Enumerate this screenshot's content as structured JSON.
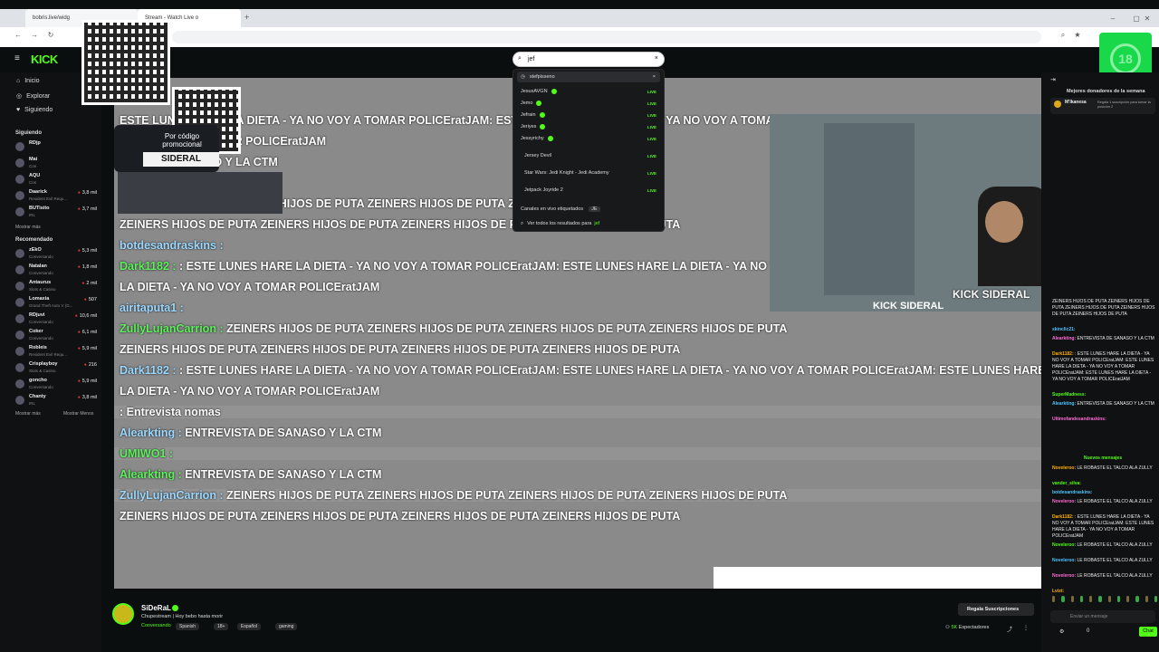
{
  "browser": {
    "tab1": "bobris.live/widg",
    "tab2": "Stream - Watch Live o",
    "url": ""
  },
  "app": {
    "logo": "KICK"
  },
  "search": {
    "value": "jef"
  },
  "nav": {
    "home": "Inicio",
    "explore": "Explorar",
    "following": "Siguiendo"
  },
  "sidebar": {
    "following_head": "Siguiendo",
    "following": [
      {
        "name": "RDjp",
        "game": "",
        "viewers": ""
      },
      {
        "name": "Mai",
        "game": "Con",
        "viewers": ""
      },
      {
        "name": "AQU",
        "game": "Con",
        "viewers": ""
      },
      {
        "name": "Daarick",
        "game": "Resident Evil Requ...",
        "viewers": "3,8 mil"
      },
      {
        "name": "BUTisito",
        "game": "IRL",
        "viewers": "3,7 mil"
      }
    ],
    "show_more": "Mostrar más",
    "recommended_head": "Recomendado",
    "recommended": [
      {
        "name": "zEkO",
        "game": "Conversando",
        "viewers": "5,3 mil"
      },
      {
        "name": "Natalan",
        "game": "Conversando",
        "viewers": "1,8 mil"
      },
      {
        "name": "Antaurus",
        "game": "Slots & Casino",
        "viewers": "2 mil"
      },
      {
        "name": "Lomaxia",
        "game": "Grand Theft Auto V (G...",
        "viewers": "507"
      },
      {
        "name": "RDjuvi",
        "game": "Conversando",
        "viewers": "10,6 mil"
      },
      {
        "name": "Coker",
        "game": "Conversando",
        "viewers": "6,1 mil"
      },
      {
        "name": "Robleis",
        "game": "Resident Evil Requ...",
        "viewers": "5,9 mil"
      },
      {
        "name": "Crisplayboy",
        "game": "Slots & Casino",
        "viewers": "216"
      },
      {
        "name": "goncho",
        "game": "Conversando",
        "viewers": "5,9 mil"
      },
      {
        "name": "Chanty",
        "game": "IRL",
        "viewers": "3,8 mil"
      }
    ],
    "show_more2": "Mostrar más",
    "show_less": "Mostrar Menos"
  },
  "promo": {
    "line1": "Por código",
    "line2": "promocional",
    "code": "SIDERAL"
  },
  "dropdown": {
    "recent": "stefpisseno",
    "channels": [
      "JesusAVGN",
      "Jemo",
      "Jefrain",
      "Jeriyes",
      "Jessyrichy"
    ],
    "categories": [
      "Jersey Devil",
      "Star Wars: Jedi Knight - Jedi Academy",
      "Jetpack Joyride 2"
    ],
    "live_label": "LIVE",
    "tagged": "Canales en vivo etiquetados",
    "tagged_chip": "JE",
    "see_all": "Ver todos los resultados para",
    "see_all_term": "jef"
  },
  "stream_chat": [
    {
      "user": "",
      "text": "ESTE LUNES HARE LA DIETA - YA NO VOY A TOMAR POLICEratJAM: ESTE LUNES HARE LA DIETA - YA NO VOY A TOMAR"
    },
    {
      "user": "",
      "text": "- YA NO VOY A TOMAR POLICEratJAM"
    },
    {
      "user": "",
      "text": "VISTA DE SANASO Y LA CTM"
    },
    {
      "user": "UltimofandesandraskIns :",
      "text": ""
    },
    {
      "user": "ZullyLujanCarrion :",
      "text": "ZEINERS HIJOS DE PUTA ZEINERS HIJOS DE PUTA ZEINERS HIJOS DE PUTA"
    },
    {
      "user": "",
      "text": "ZEINERS HIJOS DE PUTA ZEINERS HIJOS DE PUTA ZEINERS HIJOS DE PUTA ZEINERS HIJOS DE PUTA"
    },
    {
      "user": "botdesandraskins :",
      "text": ""
    },
    {
      "user": "Dark1182 :",
      "text": ": ESTE LUNES HARE LA DIETA - YA NO VOY A TOMAR POLICEratJAM: ESTE LUNES HARE LA DIETA - YA NO VOY A TOMAR POLICEratJAM: ESTE LUNES HARE"
    },
    {
      "user": "",
      "text": "LA DIETA - YA NO VOY A TOMAR POLICEratJAM"
    },
    {
      "user": "airitaputa1 :",
      "text": ""
    },
    {
      "user": "ZullyLujanCarrion :",
      "text": "ZEINERS HIJOS DE PUTA ZEINERS HIJOS DE PUTA ZEINERS HIJOS DE PUTA ZEINERS HIJOS DE PUTA"
    },
    {
      "user": "",
      "text": "ZEINERS HIJOS DE PUTA ZEINERS HIJOS DE PUTA ZEINERS HIJOS DE PUTA ZEINERS HIJOS DE PUTA"
    },
    {
      "user": "Dark1182 :",
      "text": ": ESTE LUNES HARE LA DIETA - YA NO VOY A TOMAR POLICEratJAM: ESTE LUNES HARE LA DIETA - YA NO VOY A TOMAR POLICEratJAM: ESTE LUNES HARE"
    },
    {
      "user": "",
      "text": "LA DIETA - YA NO VOY A TOMAR POLICEratJAM"
    },
    {
      "user": "",
      "text": ": Entrevista nomas"
    },
    {
      "user": "Alearkting :",
      "text": "ENTREVISTA DE SANASO Y LA CTM"
    },
    {
      "user": "UMIWO1 :",
      "text": ""
    },
    {
      "user": "Alearkting :",
      "text": "ENTREVISTA DE SANASO Y LA CTM"
    },
    {
      "user": "ZullyLujanCarrion :",
      "text": "ZEINERS HIJOS DE PUTA ZEINERS HIJOS DE PUTA ZEINERS HIJOS DE PUTA ZEINERS HIJOS DE PUTA"
    },
    {
      "user": "",
      "text": "ZEINERS HIJOS DE PUTA ZEINERS HIJOS DE PUTA ZEINERS HIJOS DE PUTA ZEINERS HIJOS DE PUTA"
    }
  ],
  "cam": {
    "label": "KICK SIDERAL",
    "label2": "KICK SIDERAL"
  },
  "channel": {
    "name": "SiDeRaL",
    "title": "Chupestream | Hoy bebo hasta morir",
    "category": "Conversando",
    "tags": [
      "Spanish",
      "18+",
      "Español",
      "gaming"
    ],
    "sub_button": "Regala Suscripciones",
    "viewers": "5K",
    "viewers_label": "Espectadores"
  },
  "chat": {
    "top_donors": "Mejores donadores de la semana",
    "donor": "M'Ikanesa",
    "donor_note": "Regala 1 suscripción para tomar la posición 2",
    "new_messages": "Nuevos mensajes",
    "messages": [
      {
        "user": "",
        "text": "ZEINERS HIJOS DE PUTA ZEINERS HIJOS DE PUTA ZEINERS HIJOS DE PUTA ZEINERS HIJOS DE PUTA ZEINERS HIJOS DE PUTA"
      },
      {
        "user": "skinclic21:",
        "text": ""
      },
      {
        "user": "Alearkting:",
        "text": "ENTREVISTA DE SANASO Y LA CTM"
      },
      {
        "user": "Dark1182:",
        "text": ": ESTE LUNES HARE LA DIETA - YA NO VOY A TOMAR POLICEratJAM: ESTE LUNES HARE LA DIETA - YA NO VOY A TOMAR POLICEratJAM: ESTE LUNES HARE LA DIETA - YA NO VOY A TOMAR POLICEratJAM"
      },
      {
        "user": "SuperMadness:",
        "text": ""
      },
      {
        "user": "Alearkting:",
        "text": "ENTREVISTA DE SANASO Y LA CTM"
      },
      {
        "user": "Ultimofandesandraskins:",
        "text": ""
      },
      {
        "user": "Noveleroo:",
        "text": "LE ROBASTE EL TALCO ALA ZULLY"
      },
      {
        "user": "vander_silva:",
        "text": ""
      },
      {
        "user": "botdesandraskins:",
        "text": ""
      },
      {
        "user": "Noveleroo:",
        "text": "LE ROBASTE EL TALCO ALA ZULLY"
      },
      {
        "user": "Dark1182:",
        "text": ": ESTE LUNES HARE LA DIETA - YA NO VOY A TOMAR POLICEratJAM: ESTE LUNES HARE LA DIETA - YA NO VOY A TOMAR POLICEratJAM"
      },
      {
        "user": "Noveleroo:",
        "text": "LE ROBASTE EL TALCO ALA ZULLY"
      },
      {
        "user": "Noveleroo:",
        "text": "LE ROBASTE EL TALCO ALA ZULLY"
      },
      {
        "user": "Noveleroo:",
        "text": "LE ROBASTE EL TALCO ALA ZULLY"
      },
      {
        "user": "Lvizt:",
        "text": ""
      }
    ],
    "input_placeholder": "Enviar un mensaje",
    "count": "0",
    "send": "Chat"
  },
  "badge": "18",
  "colors": {
    "accent": "#53fc18"
  }
}
